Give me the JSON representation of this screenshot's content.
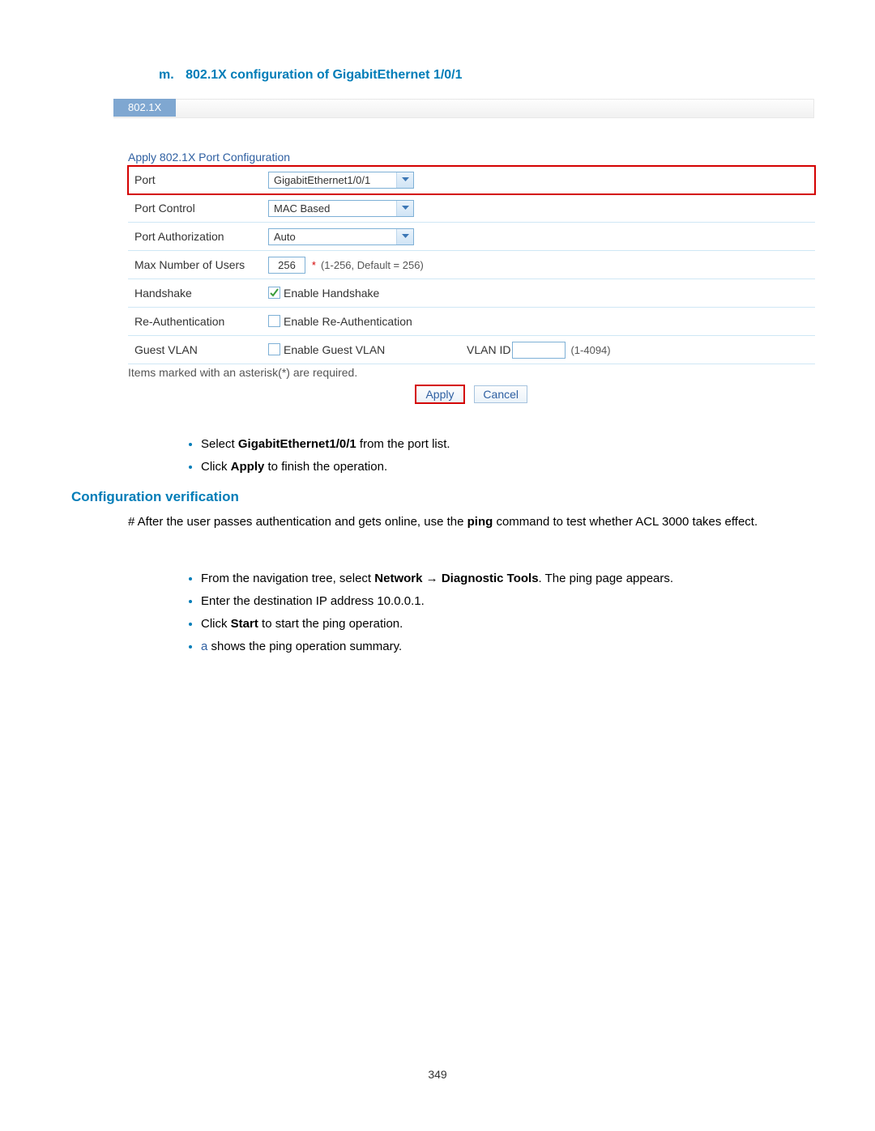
{
  "heading_m": {
    "letter": "m.",
    "text": "802.1X configuration of GigabitEthernet 1/0/1"
  },
  "tab_label": "802.1X",
  "panel_title": "Apply 802.1X Port Configuration",
  "rows": {
    "port": {
      "label": "Port",
      "value": "GigabitEthernet1/0/1"
    },
    "port_control": {
      "label": "Port Control",
      "value": "MAC Based"
    },
    "port_auth": {
      "label": "Port Authorization",
      "value": "Auto"
    },
    "max_users": {
      "label": "Max Number of Users",
      "value": "256",
      "hint": "(1-256, Default = 256)"
    },
    "handshake": {
      "label": "Handshake",
      "cb_label": "Enable Handshake"
    },
    "reauth": {
      "label": "Re-Authentication",
      "cb_label": "Enable Re-Authentication"
    },
    "guest_vlan": {
      "label": "Guest VLAN",
      "cb_label": "Enable Guest VLAN",
      "vlan_id_label": "VLAN ID",
      "vlan_hint": "(1-4094)"
    }
  },
  "footer_note": "Items marked with an asterisk(*) are required.",
  "buttons": {
    "apply": "Apply",
    "cancel": "Cancel"
  },
  "bullets1": {
    "b0": {
      "pre": "Select ",
      "bold": "GigabitEthernet1/0/1",
      "post": " from the port list."
    },
    "b1": {
      "pre": "Click ",
      "bold": "Apply",
      "post": " to finish the operation."
    }
  },
  "section2_heading": "Configuration verification",
  "body_text": {
    "pre": "# After the user passes authentication and gets online, use the ",
    "bold": "ping",
    "post": " command to test whether ACL 3000 takes effect."
  },
  "bullets2": {
    "b0": {
      "pre": "From the navigation tree, select ",
      "bold1": "Network",
      "arrow": " → ",
      "bold2": "Diagnostic Tools",
      "post": ". The ping page appears."
    },
    "b1": {
      "text": "Enter the destination IP address 10.0.0.1."
    },
    "b2": {
      "pre": "Click ",
      "bold": "Start",
      "post": " to start the ping operation."
    },
    "b3": {
      "link": "a",
      "post": " shows the ping operation summary."
    }
  },
  "page_number": "349"
}
